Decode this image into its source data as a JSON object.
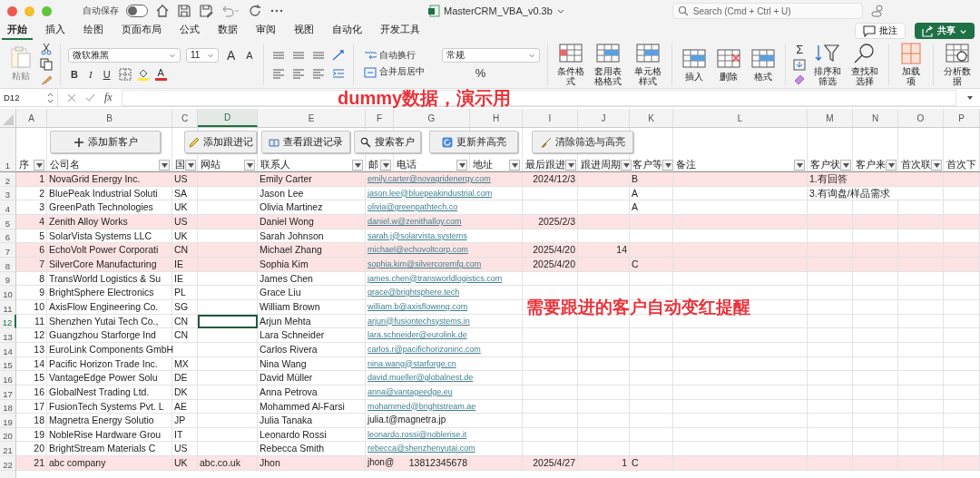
{
  "window": {
    "autosave_label": "自动保存",
    "autosave_on": false,
    "title": "MasterCRM_VBA_v0.3b",
    "search_placeholder": "Search (Cmd + Ctrl + U)"
  },
  "tabs": [
    {
      "label": "开始",
      "selected": true
    },
    {
      "label": "插入",
      "selected": false
    },
    {
      "label": "绘图",
      "selected": false
    },
    {
      "label": "页面布局",
      "selected": false
    },
    {
      "label": "公式",
      "selected": false
    },
    {
      "label": "数据",
      "selected": false
    },
    {
      "label": "审阅",
      "selected": false
    },
    {
      "label": "视图",
      "selected": false
    },
    {
      "label": "自动化",
      "selected": false
    },
    {
      "label": "开发工具",
      "selected": false
    }
  ],
  "comment_button": "批注",
  "share_button": "共享",
  "ribbon": {
    "paste": "粘贴",
    "font_name": "微软雅黑",
    "font_size": "11",
    "font_grow": "A",
    "font_shrink": "A",
    "bold": "B",
    "italic": "I",
    "underline": "U",
    "font_color": "A",
    "wrap_text": "自动换行",
    "merge_center": "合并后居中",
    "number_format": "常规",
    "percent": "%",
    "autosum": "Σ",
    "groups": [
      [
        {
          "label": "条件格式",
          "kind": "conditional"
        },
        {
          "label": "套用表格格式",
          "kind": "table"
        },
        {
          "label": "单元格样式",
          "kind": "cellstyle"
        }
      ],
      [
        {
          "label": "插入",
          "kind": "insert"
        },
        {
          "label": "删除",
          "kind": "delete"
        },
        {
          "label": "格式",
          "kind": "format"
        }
      ],
      [
        {
          "label": "排序和筛选",
          "kind": "sort"
        },
        {
          "label": "查找和选择",
          "kind": "find"
        }
      ],
      [
        {
          "label": "加载项",
          "kind": "addins"
        }
      ],
      [
        {
          "label": "分析数据",
          "kind": "analyze"
        }
      ]
    ]
  },
  "name_box": "D12",
  "fx": "fx",
  "annotations": [
    "dummy数据，演示用",
    "需要跟进的客户自动变红提醒"
  ],
  "columns": [
    {
      "label": "A",
      "selected": false
    },
    {
      "label": "B",
      "selected": false
    },
    {
      "label": "C",
      "selected": false
    },
    {
      "label": "D",
      "selected": true
    },
    {
      "label": "E",
      "selected": false
    },
    {
      "label": "F",
      "selected": false
    },
    {
      "label": "G",
      "selected": false
    },
    {
      "label": "H",
      "selected": false
    },
    {
      "label": "I",
      "selected": false
    },
    {
      "label": "J",
      "selected": false
    },
    {
      "label": "K",
      "selected": false
    },
    {
      "label": "L",
      "selected": false
    },
    {
      "label": "M",
      "selected": false
    },
    {
      "label": "N",
      "selected": false
    },
    {
      "label": "O",
      "selected": false
    },
    {
      "label": "P",
      "selected": false
    }
  ],
  "sheet_buttons": [
    {
      "label": "添加新客户",
      "kind": "plus"
    },
    {
      "label": "添加跟进记",
      "kind": "pencil"
    },
    {
      "label": "查看跟进记录",
      "kind": "book"
    },
    {
      "label": "搜索客户",
      "kind": "search"
    },
    {
      "label": "更新并高亮",
      "kind": "refresh"
    },
    {
      "label": "清除筛选与高亮",
      "kind": "broom"
    }
  ],
  "header_row": {
    "number": "1",
    "cells": [
      {
        "label": "序",
        "filter": true
      },
      {
        "label": "公司名",
        "filter": true
      },
      {
        "label": "国",
        "filter": true
      },
      {
        "label": "网站",
        "filter": true
      },
      {
        "label": "联系人",
        "filter": true
      },
      {
        "label": "邮",
        "filter": true
      },
      {
        "label": "电话",
        "filter": true
      },
      {
        "label": "地址",
        "filter": true
      },
      {
        "label": "最后跟进",
        "filter": true
      },
      {
        "label": "跟进周期",
        "filter": true
      },
      {
        "label": "客户等",
        "filter": true
      },
      {
        "label": "备注",
        "filter": true
      },
      {
        "label": "客户状",
        "filter": true
      },
      {
        "label": "客户来",
        "filter": true
      },
      {
        "label": "首次联",
        "filter": true
      },
      {
        "label": "首次下",
        "filter": false
      }
    ]
  },
  "rows": [
    {
      "number": "2",
      "highlighted": true,
      "selected": false,
      "email_link": true,
      "A": "1",
      "B": "NovaGrid Energy Inc.",
      "C": "US",
      "E": "Emily Carter",
      "F": "emily.carter@novagridenergy.com",
      "I": "2024/12/3",
      "K": "B",
      "M": "1.有回答"
    },
    {
      "number": "3",
      "highlighted": false,
      "selected": false,
      "email_link": true,
      "A": "2",
      "B": "BluePeak Industrial Soluti",
      "C": "SA",
      "E": "Jason Lee",
      "F": "jason.lee@bluepeakindustrial.com",
      "K": "A",
      "M": "3.有询盘/样品需求"
    },
    {
      "number": "4",
      "highlighted": false,
      "selected": false,
      "email_link": true,
      "A": "3",
      "B": "GreenPath Technologies",
      "C": "UK",
      "E": "Olivia Martinez",
      "F": "olivia@greenpathtech.co",
      "K": "A"
    },
    {
      "number": "5",
      "highlighted": true,
      "selected": false,
      "email_link": true,
      "A": "4",
      "B": "Zenith Alloy Works",
      "C": "US",
      "E": "Daniel Wong",
      "F": "daniel.w@zenithalloy.com",
      "I": "2025/2/3"
    },
    {
      "number": "6",
      "highlighted": false,
      "selected": false,
      "email_link": true,
      "A": "5",
      "B": "SolarVista Systems LLC",
      "C": "UK",
      "E": "Sarah Johnson",
      "F": "sarah.j@solarvista.systems"
    },
    {
      "number": "7",
      "highlighted": true,
      "selected": false,
      "email_link": true,
      "A": "6",
      "B": "EchoVolt Power Corporati",
      "C": "CN",
      "E": "Michael Zhang",
      "F": "michael@echovoltcorp.com",
      "I": "2025/4/20",
      "J": "14"
    },
    {
      "number": "8",
      "highlighted": true,
      "selected": false,
      "email_link": true,
      "A": "7",
      "B": "SilverCore Manufacturing",
      "C": "IE",
      "E": "Sophia Kim",
      "F": "sophia.kim@silvercoremfg.com",
      "I": "2025/4/20",
      "K": "C"
    },
    {
      "number": "9",
      "highlighted": false,
      "selected": false,
      "email_link": true,
      "A": "8",
      "B": "TransWorld Logistics & Su",
      "C": "IE",
      "E": "James Chen",
      "F": "james.chen@transworldlogistics.com"
    },
    {
      "number": "10",
      "highlighted": false,
      "selected": false,
      "email_link": true,
      "A": "9",
      "B": "BrightSphere Electronics",
      "C": "PL",
      "E": "Grace Liu",
      "F": "grace@brightsphere.tech"
    },
    {
      "number": "11",
      "highlighted": false,
      "selected": false,
      "email_link": true,
      "A": "10",
      "B": "AxisFlow Engineering Co.",
      "C": "SG",
      "E": "William Brown",
      "F": "william.b@axisfloweng.com"
    },
    {
      "number": "12",
      "highlighted": false,
      "selected": true,
      "email_link": true,
      "A": "11",
      "B": "Shenzhen Yutai Tech Co.,",
      "C": "CN",
      "E": "Arjun Mehta",
      "F": "arjun@fusiontechsystems.in"
    },
    {
      "number": "13",
      "highlighted": false,
      "selected": false,
      "email_link": true,
      "A": "12",
      "B": "Guangzhou Starforge Ind",
      "C": "CN",
      "E": "Lara Schneider",
      "F": "lara.schneider@eurolink.de"
    },
    {
      "number": "14",
      "highlighted": false,
      "selected": false,
      "email_link": true,
      "A": "13",
      "B": "EuroLink Components GmbH",
      "E": "Carlos Rivera",
      "F": "carlos.r@pacifichorizoninc.com"
    },
    {
      "number": "15",
      "highlighted": false,
      "selected": false,
      "email_link": true,
      "A": "14",
      "B": "Pacific Horizon Trade Inc.",
      "C": "MX",
      "E": "Nina Wang",
      "F": "nina.wang@starforge.cn"
    },
    {
      "number": "16",
      "highlighted": false,
      "selected": false,
      "email_link": true,
      "A": "15",
      "B": "VantageEdge Power Solu",
      "C": "DE",
      "E": "David Müller",
      "F": "david.mueller@globalnest.de"
    },
    {
      "number": "17",
      "highlighted": false,
      "selected": false,
      "email_link": true,
      "A": "16",
      "B": "GlobalNest Trading Ltd.",
      "C": "DK",
      "E": "Anna Petrova",
      "F": "anna@vantageedge.eu"
    },
    {
      "number": "18",
      "highlighted": false,
      "selected": false,
      "email_link": true,
      "A": "17",
      "B": "FusionTech Systems Pvt. L",
      "C": "AE",
      "E": "Mohammed Al-Farsi",
      "F": "mohammed@brightstream.ae"
    },
    {
      "number": "19",
      "highlighted": false,
      "selected": false,
      "email_link": false,
      "A": "18",
      "B": "Magnetra Energy Solutio",
      "C": "JP",
      "E": "Julia Tanaka",
      "F": "julia.t@magnetra.jp"
    },
    {
      "number": "20",
      "highlighted": false,
      "selected": false,
      "email_link": true,
      "A": "19",
      "B": "NobleRise Hardware Grou",
      "C": "IT",
      "E": "Leonardo Rossi",
      "F": "leonardo.rossi@noblerise.it"
    },
    {
      "number": "21",
      "highlighted": false,
      "selected": false,
      "email_link": true,
      "A": "20",
      "B": "BrightStream Materials C",
      "C": "US",
      "E": "Rebecca Smith",
      "F": "rebecca@shenzhenyutai.com"
    },
    {
      "number": "22",
      "highlighted": true,
      "selected": false,
      "email_link": false,
      "A": "21",
      "B": "abc company",
      "C": "UK",
      "D": "abc.co.uk",
      "E": "Jhon",
      "F": "jhon@",
      "G": "13812345678",
      "I": "2025/4/27",
      "J": "1",
      "K": "C"
    }
  ]
}
